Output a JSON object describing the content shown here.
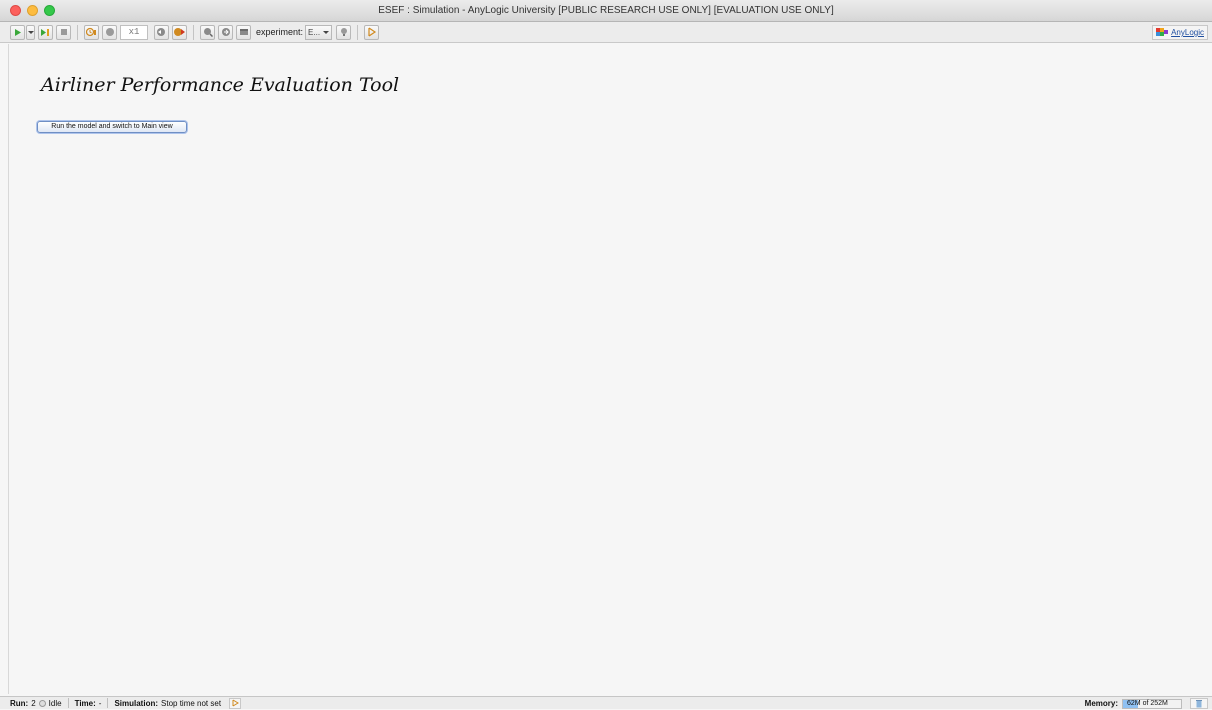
{
  "window": {
    "title": "ESEF : Simulation - AnyLogic University  [PUBLIC RESEARCH USE ONLY] [EVALUATION USE ONLY]"
  },
  "toolbar": {
    "speed_value": "x1",
    "experiment_label": "experiment:",
    "experiment_selected": "E...",
    "brand_label": "AnyLogic",
    "icons": [
      "run-icon",
      "dropdown-icon",
      "step-icon",
      "stop-icon",
      "real-time-icon",
      "virtual-time-icon",
      "slow-down-icon",
      "speed-up-icon",
      "zoom-fit-icon",
      "navigate-icon",
      "model-window-icon",
      "experiment-icon",
      "toggle-developer-panel-icon"
    ]
  },
  "main": {
    "title": "Airliner Performance Evaluation Tool",
    "run_button_label": "Run the model and switch to Main view"
  },
  "status": {
    "run_label": "Run:",
    "run_value": "2",
    "state": "Idle",
    "time_label": "Time:",
    "time_value": "-",
    "simulation_label": "Simulation:",
    "simulation_value": "Stop time not set",
    "memory_label": "Memory:",
    "memory_used": "62M",
    "memory_total_text": "of 252M",
    "memory_fraction": 0.25
  },
  "colors": {
    "accent_blue": "#8fc1f2",
    "close": "#fc605c",
    "minimize": "#fdbc40",
    "maximize": "#34c84a"
  }
}
